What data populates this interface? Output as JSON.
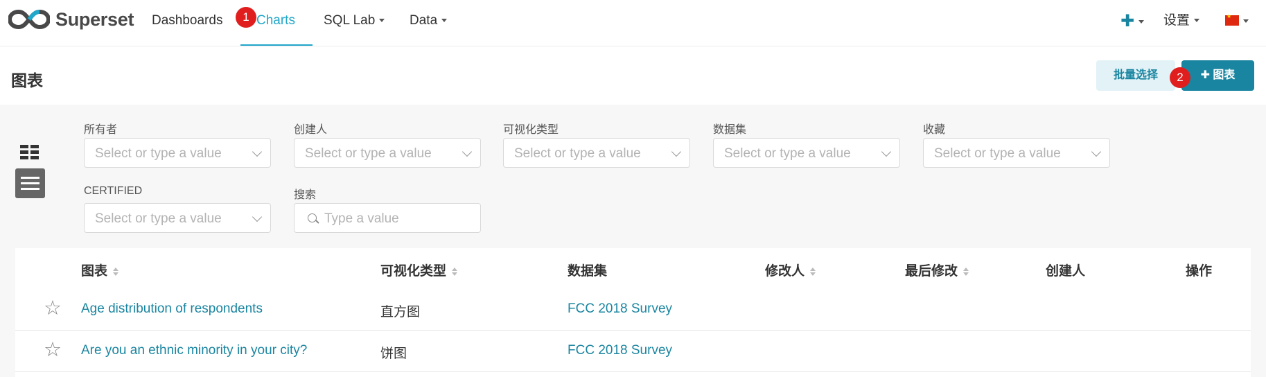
{
  "brand": {
    "name": "Superset"
  },
  "nav": {
    "dashboards": "Dashboards",
    "charts": "Charts",
    "sql_lab": "SQL Lab",
    "data": "Data",
    "settings": "设置"
  },
  "badges": {
    "first": "1",
    "second": "2"
  },
  "page": {
    "title": "图表",
    "bulk_select": "批量选择",
    "add_chart": "✚  图表"
  },
  "filters": {
    "owner": {
      "label": "所有者",
      "placeholder": "Select or type a value"
    },
    "creator": {
      "label": "创建人",
      "placeholder": "Select or type a value"
    },
    "viz_type": {
      "label": "可视化类型",
      "placeholder": "Select or type a value"
    },
    "dataset": {
      "label": "数据集",
      "placeholder": "Select or type a value"
    },
    "favorite": {
      "label": "收藏",
      "placeholder": "Select or type a value"
    },
    "certified": {
      "label": "CERTIFIED",
      "placeholder": "Select or type a value"
    },
    "search": {
      "label": "搜索",
      "placeholder": "Type a value"
    }
  },
  "table": {
    "headers": {
      "chart": "图表",
      "viz_type": "可视化类型",
      "dataset": "数据集",
      "modified_by": "修改人",
      "last_modified": "最后修改",
      "created_by": "创建人",
      "actions": "操作"
    },
    "rows": [
      {
        "name": "Age distribution of respondents",
        "viz_type": "直方图",
        "dataset": "FCC 2018 Survey"
      },
      {
        "name": "Are you an ethnic minority in your city?",
        "viz_type": "饼图",
        "dataset": "FCC 2018 Survey"
      }
    ]
  },
  "colors": {
    "accent": "#20a7c9",
    "primary": "#1a85a0",
    "badge": "#e01e1e"
  }
}
